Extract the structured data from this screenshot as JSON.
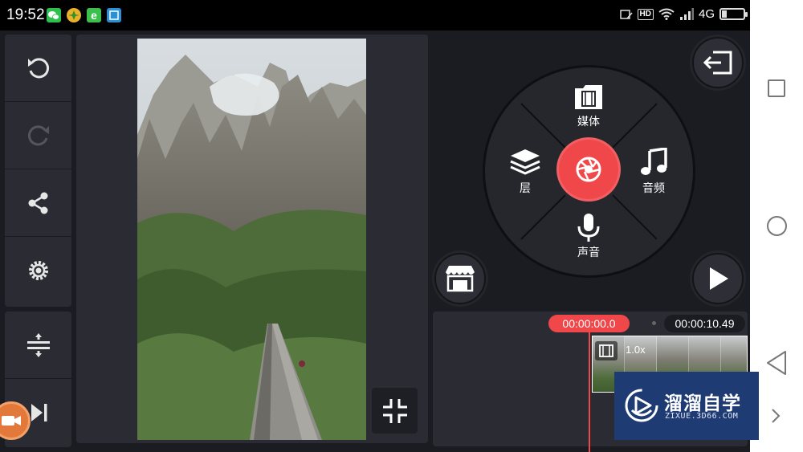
{
  "status_bar": {
    "time": "19:52",
    "network": "4G",
    "hd": "HD",
    "battery_level": 0.22,
    "app_icons": [
      "wechat-icon",
      "yellow-app-icon",
      "browser-e-icon",
      "screenshot-icon"
    ]
  },
  "left_toolbar": {
    "tools": [
      "undo-icon",
      "redo-icon",
      "share-icon",
      "settings-icon",
      "adjust-layout-icon",
      "skip-to-end-icon"
    ]
  },
  "media_wheel": {
    "top_label": "媒体",
    "left_label": "层",
    "right_label": "音频",
    "bottom_label": "声音"
  },
  "timeline": {
    "current_time": "00:00:00.0",
    "total_time": "00:00:10.49",
    "clip_speed": "1.0x"
  },
  "watermark": {
    "title": "溜溜自学",
    "subtitle": "ZIXUE.3D66.COM"
  },
  "colors": {
    "accent": "#f0474a",
    "panel": "#2b2c33",
    "background": "#1b1c21"
  }
}
